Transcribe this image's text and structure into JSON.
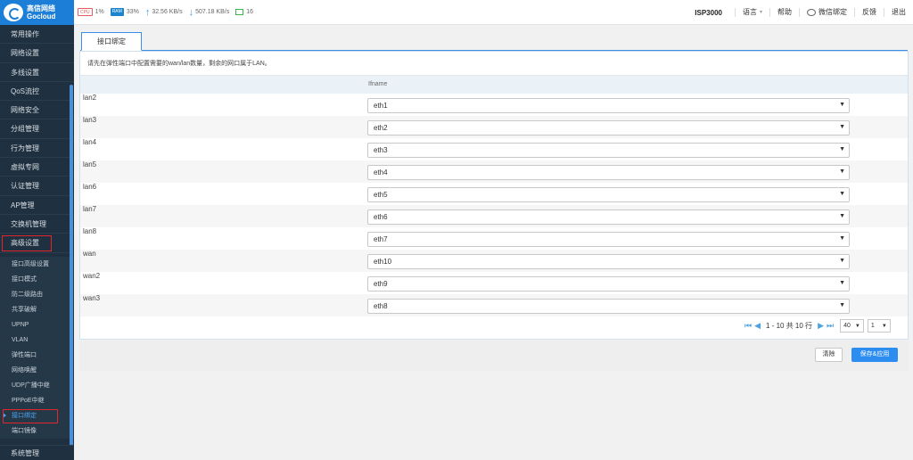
{
  "brand": {
    "name_cn": "高信网络",
    "name_en": "Gocloud"
  },
  "topbar": {
    "cpu_badge": "CPU",
    "cpu": "1%",
    "ram_badge": "RAM",
    "ram": "33%",
    "upload": "32.56 KB/s",
    "download": "507.18 KB/s",
    "connections": "16",
    "model": "ISP3000",
    "language": "语言",
    "help": "帮助",
    "wechat": "微信绑定",
    "feedback": "反馈",
    "logout": "退出"
  },
  "sidebar": {
    "items": [
      "常用操作",
      "网络设置",
      "多线设置",
      "QoS流控",
      "网络安全",
      "分组管理",
      "行为管理",
      "虚拟专网",
      "认证管理",
      "AP管理",
      "交换机管理",
      "高级设置"
    ],
    "sub_items": [
      "接口高级设置",
      "接口模式",
      "防二级路由",
      "共享破解",
      "UPNP",
      "VLAN",
      "弹性端口",
      "网络唤醒",
      "UDP广播中继",
      "PPPoE中继",
      "接口绑定",
      "端口镜像"
    ],
    "bottom": "系统管理"
  },
  "tab": {
    "label": "接口绑定"
  },
  "tip": "请先在弹性端口中配置需要的wan/lan数量，剩余的网口属于LAN。",
  "table": {
    "header": "Ifname",
    "rows": [
      {
        "name": "lan2",
        "value": "eth1"
      },
      {
        "name": "lan3",
        "value": "eth2"
      },
      {
        "name": "lan4",
        "value": "eth3"
      },
      {
        "name": "lan5",
        "value": "eth4"
      },
      {
        "name": "lan6",
        "value": "eth5"
      },
      {
        "name": "lan7",
        "value": "eth6"
      },
      {
        "name": "lan8",
        "value": "eth7"
      },
      {
        "name": "wan",
        "value": "eth10"
      },
      {
        "name": "wan2",
        "value": "eth9"
      },
      {
        "name": "wan3",
        "value": "eth8"
      }
    ]
  },
  "pager": {
    "info": "1 - 10 共 10 行",
    "page_size": "40",
    "page": "1"
  },
  "buttons": {
    "clear": "清除",
    "save": "保存&应用"
  }
}
